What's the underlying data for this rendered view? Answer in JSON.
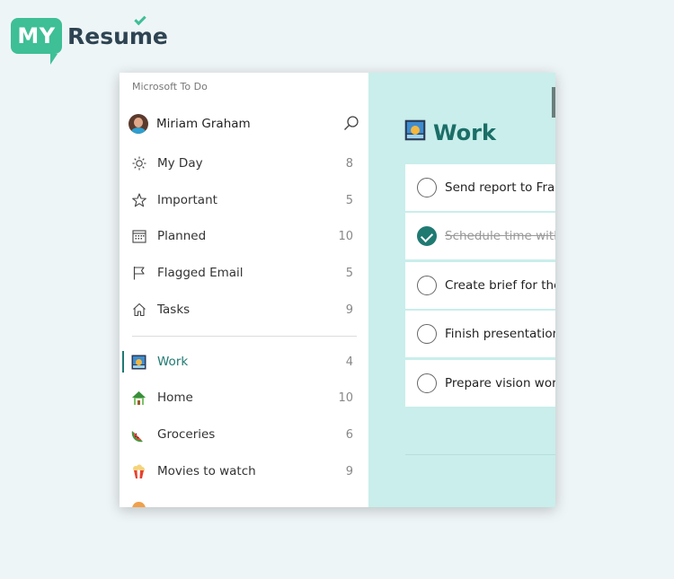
{
  "brand": {
    "badge": "MY",
    "word": "Resume"
  },
  "app": {
    "title": "Microsoft To Do"
  },
  "user": {
    "name": "Miriam Graham"
  },
  "nav": [
    {
      "label": "My Day",
      "count": "8",
      "icon": "sun-icon"
    },
    {
      "label": "Important",
      "count": "5",
      "icon": "star-icon"
    },
    {
      "label": "Planned",
      "count": "10",
      "icon": "calendar-icon"
    },
    {
      "label": "Flagged Email",
      "count": "5",
      "icon": "flag-icon"
    },
    {
      "label": "Tasks",
      "count": "9",
      "icon": "home-icon"
    }
  ],
  "lists": [
    {
      "label": "Work",
      "count": "4",
      "icon": "work-emoji-icon",
      "active": true
    },
    {
      "label": "Home",
      "count": "10",
      "icon": "house-emoji-icon"
    },
    {
      "label": "Groceries",
      "count": "6",
      "icon": "watermelon-emoji-icon"
    },
    {
      "label": "Movies to watch",
      "count": "9",
      "icon": "popcorn-emoji-icon"
    }
  ],
  "main": {
    "title": "Work",
    "tasks": [
      {
        "text": "Send report to Fran",
        "done": false
      },
      {
        "text": "Schedule time with",
        "done": true
      },
      {
        "text": "Create brief for the",
        "done": false
      },
      {
        "text": "Finish presentation",
        "done": false
      },
      {
        "text": "Prepare vision work",
        "done": false
      }
    ]
  },
  "colors": {
    "accent": "#1f7a72",
    "main_bg": "#c9eeeb",
    "brand_green": "#3ebf95",
    "brand_dark": "#2e4452"
  }
}
